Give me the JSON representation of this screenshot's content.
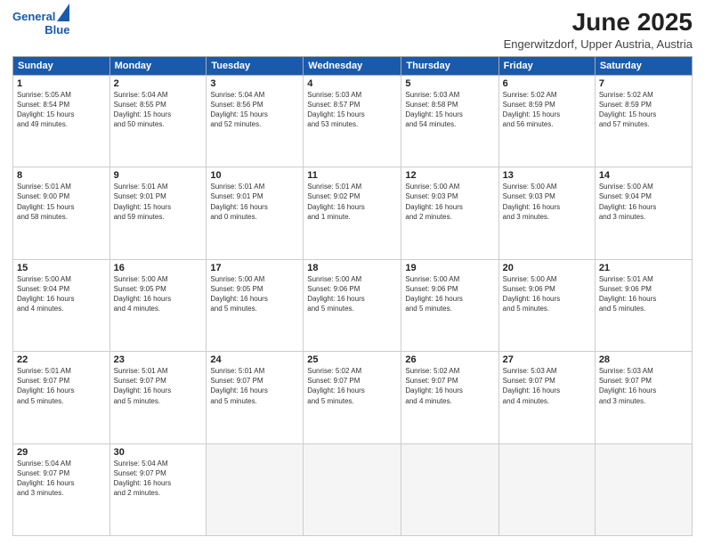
{
  "logo": {
    "line1": "General",
    "line2": "Blue"
  },
  "title": "June 2025",
  "location": "Engerwitzdorf, Upper Austria, Austria",
  "days_of_week": [
    "Sunday",
    "Monday",
    "Tuesday",
    "Wednesday",
    "Thursday",
    "Friday",
    "Saturday"
  ],
  "weeks": [
    [
      {
        "day": "1",
        "info": "Sunrise: 5:05 AM\nSunset: 8:54 PM\nDaylight: 15 hours\nand 49 minutes."
      },
      {
        "day": "2",
        "info": "Sunrise: 5:04 AM\nSunset: 8:55 PM\nDaylight: 15 hours\nand 50 minutes."
      },
      {
        "day": "3",
        "info": "Sunrise: 5:04 AM\nSunset: 8:56 PM\nDaylight: 15 hours\nand 52 minutes."
      },
      {
        "day": "4",
        "info": "Sunrise: 5:03 AM\nSunset: 8:57 PM\nDaylight: 15 hours\nand 53 minutes."
      },
      {
        "day": "5",
        "info": "Sunrise: 5:03 AM\nSunset: 8:58 PM\nDaylight: 15 hours\nand 54 minutes."
      },
      {
        "day": "6",
        "info": "Sunrise: 5:02 AM\nSunset: 8:59 PM\nDaylight: 15 hours\nand 56 minutes."
      },
      {
        "day": "7",
        "info": "Sunrise: 5:02 AM\nSunset: 8:59 PM\nDaylight: 15 hours\nand 57 minutes."
      }
    ],
    [
      {
        "day": "8",
        "info": "Sunrise: 5:01 AM\nSunset: 9:00 PM\nDaylight: 15 hours\nand 58 minutes."
      },
      {
        "day": "9",
        "info": "Sunrise: 5:01 AM\nSunset: 9:01 PM\nDaylight: 15 hours\nand 59 minutes."
      },
      {
        "day": "10",
        "info": "Sunrise: 5:01 AM\nSunset: 9:01 PM\nDaylight: 16 hours\nand 0 minutes."
      },
      {
        "day": "11",
        "info": "Sunrise: 5:01 AM\nSunset: 9:02 PM\nDaylight: 16 hours\nand 1 minute."
      },
      {
        "day": "12",
        "info": "Sunrise: 5:00 AM\nSunset: 9:03 PM\nDaylight: 16 hours\nand 2 minutes."
      },
      {
        "day": "13",
        "info": "Sunrise: 5:00 AM\nSunset: 9:03 PM\nDaylight: 16 hours\nand 3 minutes."
      },
      {
        "day": "14",
        "info": "Sunrise: 5:00 AM\nSunset: 9:04 PM\nDaylight: 16 hours\nand 3 minutes."
      }
    ],
    [
      {
        "day": "15",
        "info": "Sunrise: 5:00 AM\nSunset: 9:04 PM\nDaylight: 16 hours\nand 4 minutes."
      },
      {
        "day": "16",
        "info": "Sunrise: 5:00 AM\nSunset: 9:05 PM\nDaylight: 16 hours\nand 4 minutes."
      },
      {
        "day": "17",
        "info": "Sunrise: 5:00 AM\nSunset: 9:05 PM\nDaylight: 16 hours\nand 5 minutes."
      },
      {
        "day": "18",
        "info": "Sunrise: 5:00 AM\nSunset: 9:06 PM\nDaylight: 16 hours\nand 5 minutes."
      },
      {
        "day": "19",
        "info": "Sunrise: 5:00 AM\nSunset: 9:06 PM\nDaylight: 16 hours\nand 5 minutes."
      },
      {
        "day": "20",
        "info": "Sunrise: 5:00 AM\nSunset: 9:06 PM\nDaylight: 16 hours\nand 5 minutes."
      },
      {
        "day": "21",
        "info": "Sunrise: 5:01 AM\nSunset: 9:06 PM\nDaylight: 16 hours\nand 5 minutes."
      }
    ],
    [
      {
        "day": "22",
        "info": "Sunrise: 5:01 AM\nSunset: 9:07 PM\nDaylight: 16 hours\nand 5 minutes."
      },
      {
        "day": "23",
        "info": "Sunrise: 5:01 AM\nSunset: 9:07 PM\nDaylight: 16 hours\nand 5 minutes."
      },
      {
        "day": "24",
        "info": "Sunrise: 5:01 AM\nSunset: 9:07 PM\nDaylight: 16 hours\nand 5 minutes."
      },
      {
        "day": "25",
        "info": "Sunrise: 5:02 AM\nSunset: 9:07 PM\nDaylight: 16 hours\nand 5 minutes."
      },
      {
        "day": "26",
        "info": "Sunrise: 5:02 AM\nSunset: 9:07 PM\nDaylight: 16 hours\nand 4 minutes."
      },
      {
        "day": "27",
        "info": "Sunrise: 5:03 AM\nSunset: 9:07 PM\nDaylight: 16 hours\nand 4 minutes."
      },
      {
        "day": "28",
        "info": "Sunrise: 5:03 AM\nSunset: 9:07 PM\nDaylight: 16 hours\nand 3 minutes."
      }
    ],
    [
      {
        "day": "29",
        "info": "Sunrise: 5:04 AM\nSunset: 9:07 PM\nDaylight: 16 hours\nand 3 minutes."
      },
      {
        "day": "30",
        "info": "Sunrise: 5:04 AM\nSunset: 9:07 PM\nDaylight: 16 hours\nand 2 minutes."
      },
      {
        "day": "",
        "info": ""
      },
      {
        "day": "",
        "info": ""
      },
      {
        "day": "",
        "info": ""
      },
      {
        "day": "",
        "info": ""
      },
      {
        "day": "",
        "info": ""
      }
    ]
  ]
}
